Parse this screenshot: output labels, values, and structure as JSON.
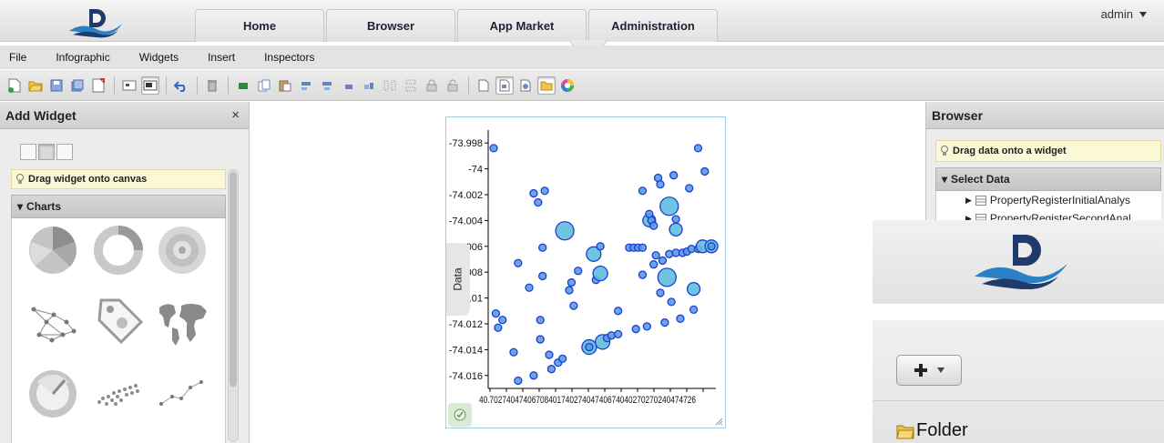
{
  "nav": {
    "tabs": [
      "Home",
      "Browser",
      "App Market",
      "Administration"
    ],
    "user": "admin"
  },
  "menu": [
    "File",
    "Infographic",
    "Widgets",
    "Insert",
    "Inspectors"
  ],
  "toolbar_icons": [
    "new-doc-icon",
    "open-folder-icon",
    "save-icon",
    "save-as-icon",
    "export-icon",
    "small-view-icon",
    "large-view-icon",
    "undo-icon",
    "delete-icon",
    "group-icon",
    "copy-icon",
    "paste-icon",
    "align-left-icon",
    "align-center-icon",
    "align-right-icon",
    "align-bottom-icon",
    "distribute-h-icon",
    "distribute-v-icon",
    "lock-icon",
    "unlock-icon",
    "page-icon",
    "page-view-icon",
    "page-detail-icon",
    "folder-icon",
    "color-wheel-icon"
  ],
  "left_panel": {
    "title": "Add Widget",
    "close": "×",
    "hint": "Drag widget onto canvas",
    "section": "Charts",
    "widgets": [
      "pie-chart-icon",
      "donut-chart-icon",
      "radial-chart-icon",
      "network-graph-icon",
      "tag-icon",
      "world-map-icon",
      "gauge-chart-icon",
      "scatter-plot-icon",
      "line-scatter-icon"
    ]
  },
  "widget": {
    "data_tab": "Data"
  },
  "chart_data": {
    "type": "scatter",
    "x_tick_label": "40.7027404740670840174027404740674040270270240474726",
    "y_ticks": [
      "-73.998",
      "-74",
      "-74.002",
      "-74.004",
      "006",
      "008",
      ".01",
      "-74.012",
      "-74.014",
      "-74.016"
    ],
    "ylim": [
      -74.017,
      -73.997
    ],
    "xlim": [
      0,
      100
    ],
    "points": [
      {
        "x": 0,
        "y": -73.9984,
        "r": 4
      },
      {
        "x": 1,
        "y": -74.0112,
        "r": 4
      },
      {
        "x": 2,
        "y": -74.0123,
        "r": 4
      },
      {
        "x": 4,
        "y": -74.0117,
        "r": 4
      },
      {
        "x": 9,
        "y": -74.0142,
        "r": 4
      },
      {
        "x": 11,
        "y": -74.0164,
        "r": 4
      },
      {
        "x": 11,
        "y": -74.0073,
        "r": 4
      },
      {
        "x": 16,
        "y": -74.0092,
        "r": 4
      },
      {
        "x": 18,
        "y": -74.016,
        "r": 4
      },
      {
        "x": 18,
        "y": -74.0019,
        "r": 4
      },
      {
        "x": 20,
        "y": -74.0026,
        "r": 4
      },
      {
        "x": 21,
        "y": -74.0117,
        "r": 4
      },
      {
        "x": 21,
        "y": -74.0132,
        "r": 4
      },
      {
        "x": 22,
        "y": -74.0083,
        "r": 4
      },
      {
        "x": 22,
        "y": -74.0061,
        "r": 4
      },
      {
        "x": 23,
        "y": -74.0017,
        "r": 4
      },
      {
        "x": 25,
        "y": -74.0144,
        "r": 4
      },
      {
        "x": 26,
        "y": -74.0155,
        "r": 4
      },
      {
        "x": 29,
        "y": -74.015,
        "r": 4
      },
      {
        "x": 31,
        "y": -74.0147,
        "r": 4
      },
      {
        "x": 32,
        "y": -74.0048,
        "r": 10
      },
      {
        "x": 34,
        "y": -74.0094,
        "r": 4
      },
      {
        "x": 35,
        "y": -74.0088,
        "r": 4
      },
      {
        "x": 36,
        "y": -74.0106,
        "r": 4
      },
      {
        "x": 38,
        "y": -74.0079,
        "r": 4
      },
      {
        "x": 43,
        "y": -74.0138,
        "r": 8
      },
      {
        "x": 43,
        "y": -74.0138,
        "r": 4
      },
      {
        "x": 45,
        "y": -74.0066,
        "r": 8
      },
      {
        "x": 46,
        "y": -74.0086,
        "r": 4
      },
      {
        "x": 48,
        "y": -74.006,
        "r": 4
      },
      {
        "x": 48,
        "y": -74.0081,
        "r": 8
      },
      {
        "x": 49,
        "y": -74.0134,
        "r": 8
      },
      {
        "x": 51,
        "y": -74.0131,
        "r": 4
      },
      {
        "x": 53,
        "y": -74.0129,
        "r": 4
      },
      {
        "x": 56,
        "y": -74.0128,
        "r": 4
      },
      {
        "x": 56,
        "y": -74.011,
        "r": 4
      },
      {
        "x": 61,
        "y": -74.0061,
        "r": 4
      },
      {
        "x": 63,
        "y": -74.0061,
        "r": 4
      },
      {
        "x": 64,
        "y": -74.0124,
        "r": 4
      },
      {
        "x": 65,
        "y": -74.0061,
        "r": 4
      },
      {
        "x": 67,
        "y": -74.0061,
        "r": 4
      },
      {
        "x": 67,
        "y": -74.0017,
        "r": 4
      },
      {
        "x": 67,
        "y": -74.0082,
        "r": 4
      },
      {
        "x": 69,
        "y": -74.0122,
        "r": 4
      },
      {
        "x": 70,
        "y": -74.004,
        "r": 7
      },
      {
        "x": 70,
        "y": -74.0035,
        "r": 4
      },
      {
        "x": 71,
        "y": -74.004,
        "r": 4
      },
      {
        "x": 72,
        "y": -74.0074,
        "r": 4
      },
      {
        "x": 72,
        "y": -74.0044,
        "r": 4
      },
      {
        "x": 73,
        "y": -74.0067,
        "r": 4
      },
      {
        "x": 74,
        "y": -74.0007,
        "r": 4
      },
      {
        "x": 75,
        "y": -74.0096,
        "r": 4
      },
      {
        "x": 75,
        "y": -74.0012,
        "r": 4
      },
      {
        "x": 76,
        "y": -74.0071,
        "r": 4
      },
      {
        "x": 77,
        "y": -74.0119,
        "r": 4
      },
      {
        "x": 78,
        "y": -74.0084,
        "r": 10
      },
      {
        "x": 79,
        "y": -74.0066,
        "r": 4
      },
      {
        "x": 79,
        "y": -74.0029,
        "r": 10
      },
      {
        "x": 80,
        "y": -74.0103,
        "r": 4
      },
      {
        "x": 81,
        "y": -74.0005,
        "r": 4
      },
      {
        "x": 82,
        "y": -74.0047,
        "r": 7
      },
      {
        "x": 82,
        "y": -74.0039,
        "r": 4
      },
      {
        "x": 82,
        "y": -74.0065,
        "r": 4
      },
      {
        "x": 84,
        "y": -74.0116,
        "r": 4
      },
      {
        "x": 85,
        "y": -74.0065,
        "r": 4
      },
      {
        "x": 87,
        "y": -74.0064,
        "r": 4
      },
      {
        "x": 88,
        "y": -74.0015,
        "r": 4
      },
      {
        "x": 89,
        "y": -74.0062,
        "r": 4
      },
      {
        "x": 90,
        "y": -74.0109,
        "r": 4
      },
      {
        "x": 90,
        "y": -74.0093,
        "r": 7
      },
      {
        "x": 92,
        "y": -73.9984,
        "r": 4
      },
      {
        "x": 92,
        "y": -74.0062,
        "r": 4
      },
      {
        "x": 94,
        "y": -74.006,
        "r": 7
      },
      {
        "x": 95,
        "y": -74.0002,
        "r": 4
      },
      {
        "x": 98,
        "y": -74.006,
        "r": 7
      },
      {
        "x": 98,
        "y": -74.006,
        "r": 4
      }
    ]
  },
  "right_panel": {
    "title": "Browser",
    "hint": "Drag data onto a widget",
    "section": "Select Data",
    "items": [
      "PropertyRegisterInitialAnalys",
      "PropertyRegisterSecondAnal"
    ]
  },
  "overlay": {
    "folder_label": "Folder"
  }
}
